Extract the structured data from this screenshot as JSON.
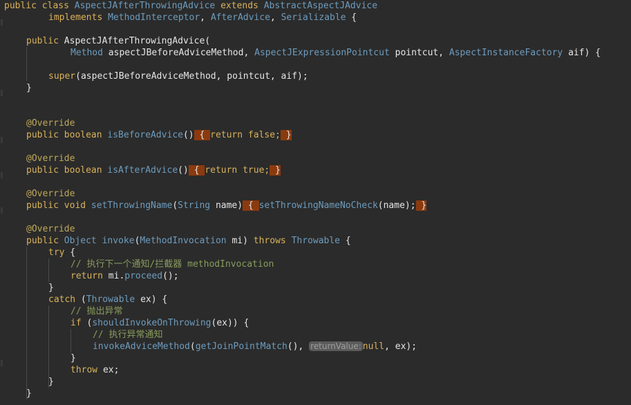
{
  "code": {
    "l1": [
      "public class ",
      "AspectJAfterThrowingAdvice",
      " extends ",
      "AbstractAspectJAdvice"
    ],
    "l2": [
      "implements ",
      "MethodInterceptor",
      ", ",
      "AfterAdvice",
      ", ",
      "Serializable",
      " {"
    ],
    "l3": [
      "public ",
      "AspectJAfterThrowingAdvice",
      "("
    ],
    "l4": [
      "Method",
      " aspectJBeforeAdviceMethod, ",
      "AspectJExpressionPointcut",
      " pointcut, ",
      "AspectInstanceFactory",
      " aif) {"
    ],
    "l5": [
      "super",
      "(aspectJBeforeAdviceMethod, pointcut, aif);"
    ],
    "l6": [
      "}"
    ],
    "l7": [
      "@Override"
    ],
    "l8": [
      "public boolean ",
      "isBeforeAdvice",
      "()",
      " { ",
      "return false;",
      " }"
    ],
    "l9": [
      "@Override"
    ],
    "l10": [
      "public boolean ",
      "isAfterAdvice",
      "()",
      " { ",
      "return true;",
      " }"
    ],
    "l11": [
      "@Override"
    ],
    "l12": [
      "public void ",
      "setThrowingName",
      "(",
      "String",
      " name)",
      " { ",
      "setThrowingNameNoCheck",
      "(name);",
      " }"
    ],
    "l13": [
      "@Override"
    ],
    "l14": [
      "public ",
      "Object",
      " ",
      "invoke",
      "(",
      "MethodInvocation",
      " mi) ",
      "throws ",
      "Throwable",
      " {"
    ],
    "l15": [
      "try",
      " {"
    ],
    "l16": [
      "// 执行下一个通知/拦截器 methodInvocation"
    ],
    "l17": [
      "return ",
      "mi.",
      "proceed",
      "();"
    ],
    "l18": [
      "}"
    ],
    "l19": [
      "catch ",
      "(",
      "Throwable",
      " ex) {"
    ],
    "l20": [
      "// 抛出异常"
    ],
    "l21": [
      "if ",
      "(",
      "shouldInvokeOnThrowing",
      "(ex)) {"
    ],
    "l22": [
      "// 执行异常通知"
    ],
    "l23": [
      "invokeAdviceMethod",
      "(",
      "getJoinPointMatch",
      "(), ",
      "returnValue:",
      "null",
      ", ex);"
    ],
    "l24": [
      "}"
    ],
    "l25": [
      "throw ",
      "ex;"
    ],
    "l26": [
      "}"
    ],
    "l27": [
      "}"
    ]
  }
}
